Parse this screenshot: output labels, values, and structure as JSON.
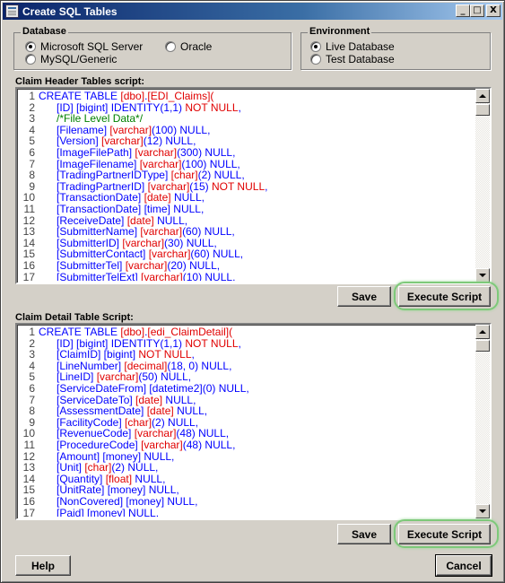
{
  "window": {
    "title": "Create SQL Tables",
    "controls": {
      "minimize": "_",
      "maximize": "□",
      "close": "X"
    }
  },
  "database_group": {
    "title": "Database",
    "options": [
      {
        "label": "Microsoft SQL Server",
        "checked": true
      },
      {
        "label": "Oracle",
        "checked": false
      },
      {
        "label": "MySQL/Generic",
        "checked": false
      }
    ]
  },
  "environment_group": {
    "title": "Environment",
    "options": [
      {
        "label": "Live Database",
        "checked": true
      },
      {
        "label": "Test Database",
        "checked": false
      }
    ]
  },
  "header_script": {
    "label": "Claim Header Tables script:",
    "save_label": "Save",
    "execute_label": "Execute Script",
    "lines": [
      {
        "n": "1",
        "indent": 0,
        "parts": [
          [
            "kw",
            "CREATE TABLE "
          ],
          [
            "red",
            "[dbo]"
          ],
          [
            "kw",
            "."
          ],
          [
            "red",
            "[EDI_Claims]"
          ],
          [
            "red",
            "("
          ]
        ]
      },
      {
        "n": "2",
        "indent": 1,
        "parts": [
          [
            "kw",
            "[ID] [bigint] IDENTITY(1,1) "
          ],
          [
            "red",
            "NOT NULL"
          ],
          [
            "kw",
            ","
          ]
        ]
      },
      {
        "n": "3",
        "indent": 1,
        "parts": [
          [
            "cm",
            "/*File Level Data*/"
          ]
        ]
      },
      {
        "n": "4",
        "indent": 1,
        "parts": [
          [
            "kw",
            "[Filename] "
          ],
          [
            "red",
            "[varchar]"
          ],
          [
            "kw",
            "(100) NULL,"
          ]
        ]
      },
      {
        "n": "5",
        "indent": 1,
        "parts": [
          [
            "kw",
            "[Version] "
          ],
          [
            "red",
            "[varchar]"
          ],
          [
            "kw",
            "(12) NULL,"
          ]
        ]
      },
      {
        "n": "6",
        "indent": 1,
        "parts": [
          [
            "kw",
            "[ImageFilePath] "
          ],
          [
            "red",
            "[varchar]"
          ],
          [
            "kw",
            "(300) NULL,"
          ]
        ]
      },
      {
        "n": "7",
        "indent": 1,
        "parts": [
          [
            "kw",
            "[ImageFilename] "
          ],
          [
            "red",
            "[varchar]"
          ],
          [
            "kw",
            "(100) NULL,"
          ]
        ]
      },
      {
        "n": "8",
        "indent": 1,
        "parts": [
          [
            "kw",
            "[TradingPartnerIDType] "
          ],
          [
            "red",
            "[char]"
          ],
          [
            "kw",
            "(2) NULL,"
          ]
        ]
      },
      {
        "n": "9",
        "indent": 1,
        "parts": [
          [
            "kw",
            "[TradingPartnerID] "
          ],
          [
            "red",
            "[varchar]"
          ],
          [
            "kw",
            "(15) "
          ],
          [
            "red",
            "NOT NULL"
          ],
          [
            "kw",
            ","
          ]
        ]
      },
      {
        "n": "10",
        "indent": 1,
        "parts": [
          [
            "kw",
            "[TransactionDate] "
          ],
          [
            "red",
            "[date]"
          ],
          [
            "kw",
            " NULL,"
          ]
        ]
      },
      {
        "n": "11",
        "indent": 1,
        "parts": [
          [
            "kw",
            "[TransactionDate] [time] NULL,"
          ]
        ]
      },
      {
        "n": "12",
        "indent": 1,
        "parts": [
          [
            "kw",
            "[ReceiveDate] "
          ],
          [
            "red",
            "[date]"
          ],
          [
            "kw",
            " NULL,"
          ]
        ]
      },
      {
        "n": "13",
        "indent": 1,
        "parts": [
          [
            "kw",
            "[SubmitterName] "
          ],
          [
            "red",
            "[varchar]"
          ],
          [
            "kw",
            "(60) NULL,"
          ]
        ]
      },
      {
        "n": "14",
        "indent": 1,
        "parts": [
          [
            "kw",
            "[SubmitterID] "
          ],
          [
            "red",
            "[varchar]"
          ],
          [
            "kw",
            "(30) NULL,"
          ]
        ]
      },
      {
        "n": "15",
        "indent": 1,
        "parts": [
          [
            "kw",
            "[SubmitterContact] "
          ],
          [
            "red",
            "[varchar]"
          ],
          [
            "kw",
            "(60) NULL,"
          ]
        ]
      },
      {
        "n": "16",
        "indent": 1,
        "parts": [
          [
            "kw",
            "[SubmitterTel] "
          ],
          [
            "red",
            "[varchar]"
          ],
          [
            "kw",
            "(20) NULL,"
          ]
        ]
      },
      {
        "n": "17",
        "indent": 1,
        "parts": [
          [
            "kw",
            "[SubmitterTelExt] "
          ],
          [
            "red",
            "[varchar]"
          ],
          [
            "kw",
            "(10) NULL,"
          ]
        ]
      }
    ]
  },
  "detail_script": {
    "label": "Claim Detail Table Script:",
    "save_label": "Save",
    "execute_label": "Execute Script",
    "lines": [
      {
        "n": "1",
        "indent": 0,
        "parts": [
          [
            "kw",
            "CREATE TABLE "
          ],
          [
            "red",
            "[dbo]"
          ],
          [
            "kw",
            "."
          ],
          [
            "red",
            "[edi_ClaimDetail]"
          ],
          [
            "red",
            "("
          ]
        ]
      },
      {
        "n": "2",
        "indent": 1,
        "parts": [
          [
            "kw",
            "[ID] [bigint] IDENTITY(1,1) "
          ],
          [
            "red",
            "NOT NULL"
          ],
          [
            "kw",
            ","
          ]
        ]
      },
      {
        "n": "3",
        "indent": 1,
        "parts": [
          [
            "kw",
            "[ClaimID] [bigint] "
          ],
          [
            "red",
            "NOT NULL"
          ],
          [
            "kw",
            ","
          ]
        ]
      },
      {
        "n": "4",
        "indent": 1,
        "parts": [
          [
            "kw",
            "[LineNumber] "
          ],
          [
            "red",
            "[decimal]"
          ],
          [
            "kw",
            "(18, 0) NULL,"
          ]
        ]
      },
      {
        "n": "5",
        "indent": 1,
        "parts": [
          [
            "kw",
            "[LineID] "
          ],
          [
            "red",
            "[varchar]"
          ],
          [
            "kw",
            "(50) NULL,"
          ]
        ]
      },
      {
        "n": "6",
        "indent": 1,
        "parts": [
          [
            "kw",
            "[ServiceDateFrom] [datetime2](0) NULL,"
          ]
        ]
      },
      {
        "n": "7",
        "indent": 1,
        "parts": [
          [
            "kw",
            "[ServiceDateTo] "
          ],
          [
            "red",
            "[date]"
          ],
          [
            "kw",
            " NULL,"
          ]
        ]
      },
      {
        "n": "8",
        "indent": 1,
        "parts": [
          [
            "kw",
            "[AssessmentDate] "
          ],
          [
            "red",
            "[date]"
          ],
          [
            "kw",
            " NULL,"
          ]
        ]
      },
      {
        "n": "9",
        "indent": 1,
        "parts": [
          [
            "kw",
            "[FacilityCode] "
          ],
          [
            "red",
            "[char]"
          ],
          [
            "kw",
            "(2) NULL,"
          ]
        ]
      },
      {
        "n": "10",
        "indent": 1,
        "parts": [
          [
            "kw",
            "[RevenueCode] "
          ],
          [
            "red",
            "[varchar]"
          ],
          [
            "kw",
            "(48) NULL,"
          ]
        ]
      },
      {
        "n": "11",
        "indent": 1,
        "parts": [
          [
            "kw",
            "[ProcedureCode] "
          ],
          [
            "red",
            "[varchar]"
          ],
          [
            "kw",
            "(48) NULL,"
          ]
        ]
      },
      {
        "n": "12",
        "indent": 1,
        "parts": [
          [
            "kw",
            "[Amount] [money] NULL,"
          ]
        ]
      },
      {
        "n": "13",
        "indent": 1,
        "parts": [
          [
            "kw",
            "[Unit] "
          ],
          [
            "red",
            "[char]"
          ],
          [
            "kw",
            "(2) NULL,"
          ]
        ]
      },
      {
        "n": "14",
        "indent": 1,
        "parts": [
          [
            "kw",
            "[Quantity] "
          ],
          [
            "red",
            "[float]"
          ],
          [
            "kw",
            " NULL,"
          ]
        ]
      },
      {
        "n": "15",
        "indent": 1,
        "parts": [
          [
            "kw",
            "[UnitRate] [money] NULL,"
          ]
        ]
      },
      {
        "n": "16",
        "indent": 1,
        "parts": [
          [
            "kw",
            "[NonCovered] [money] NULL,"
          ]
        ]
      },
      {
        "n": "17",
        "indent": 1,
        "parts": [
          [
            "kw",
            "[Paid] [money] NULL,"
          ]
        ]
      }
    ]
  },
  "footer": {
    "help_label": "Help",
    "cancel_label": "Cancel"
  },
  "colors": {
    "keyword": "#0000ff",
    "datatype": "#e00000",
    "comment": "#008000",
    "highlight": "#7ec97a"
  }
}
